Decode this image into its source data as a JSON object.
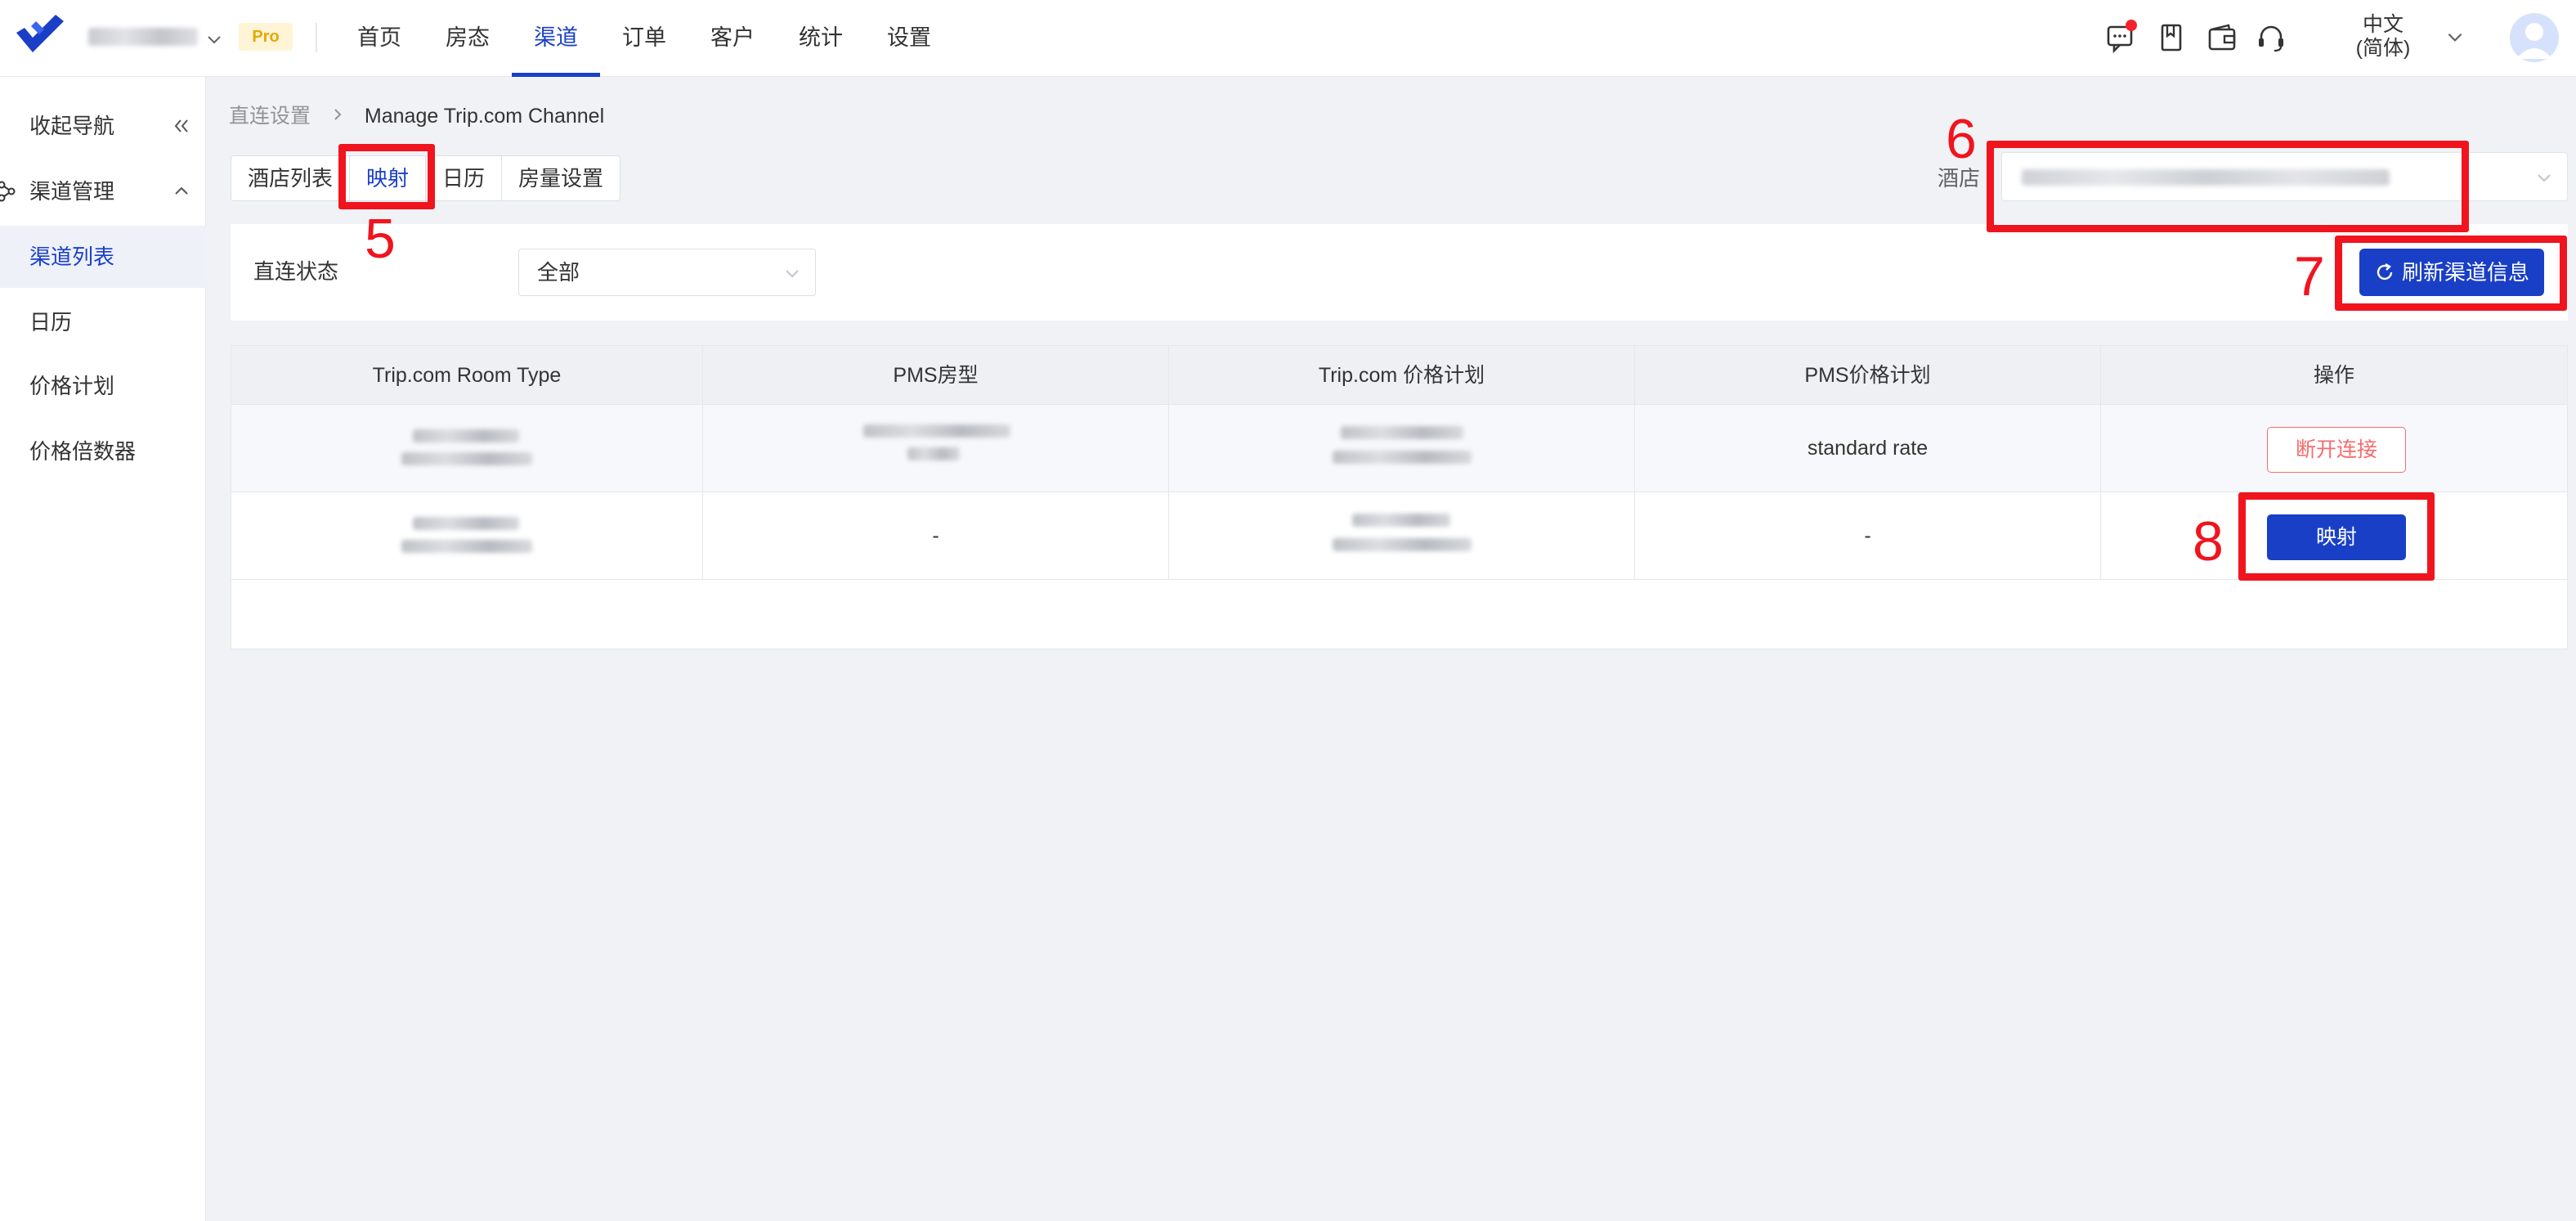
{
  "app": {
    "pro_badge": "Pro",
    "nav": [
      "首页",
      "房态",
      "渠道",
      "订单",
      "客户",
      "统计",
      "设置"
    ],
    "active_nav_index": 2,
    "language_line1": "中文",
    "language_line2": "(简体)"
  },
  "sidebar": {
    "collapse_label": "收起导航",
    "group_label": "渠道管理",
    "items": [
      "渠道列表",
      "日历",
      "价格计划",
      "价格倍数器"
    ],
    "active_index": 0
  },
  "breadcrumb": {
    "parent": "直连设置",
    "current": "Manage Trip.com Channel"
  },
  "tabs": {
    "items": [
      "酒店列表",
      "映射",
      "日历",
      "房量设置"
    ],
    "active_index": 1
  },
  "hotel": {
    "label": "酒店"
  },
  "filter": {
    "label": "直连状态",
    "value": "全部",
    "refresh_button": "刷新渠道信息"
  },
  "table": {
    "columns": [
      "Trip.com Room Type",
      "PMS房型",
      "Trip.com 价格计划",
      "PMS价格计划",
      "操作"
    ],
    "rows": [
      {
        "pms_room_type": "",
        "pms_rate_plan": "standard rate",
        "action": "断开连接"
      },
      {
        "pms_room_type": "-",
        "pms_rate_plan": "-",
        "action": "映射"
      }
    ]
  },
  "annotations": [
    "5",
    "6",
    "7",
    "8"
  ],
  "colors": {
    "primary": "#1a3fc7",
    "annotation": "#f0141e",
    "danger": "#f56c6c",
    "pro_badge": "#e6a800"
  }
}
